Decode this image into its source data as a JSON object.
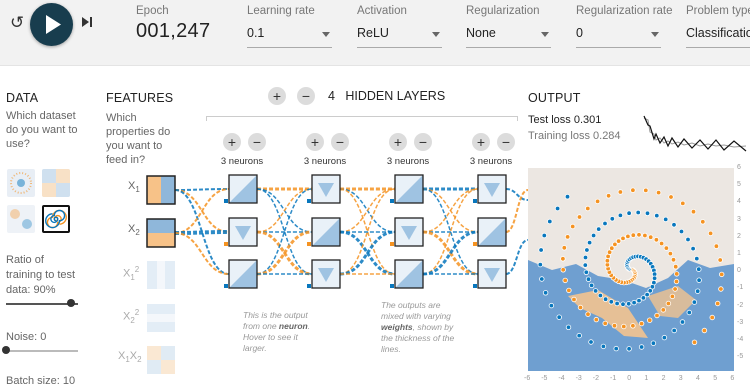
{
  "controls": {
    "reset_icon": "reset-icon",
    "play_icon": "play-icon",
    "step_icon": "step-icon"
  },
  "epoch": {
    "label": "Epoch",
    "value": "001,247"
  },
  "learning_rate": {
    "label": "Learning rate",
    "value": "0.1"
  },
  "activation": {
    "label": "Activation",
    "value": "ReLU"
  },
  "regularization": {
    "label": "Regularization",
    "value": "None"
  },
  "regularization_rate": {
    "label": "Regularization rate",
    "value": "0"
  },
  "problem_type": {
    "label": "Problem type",
    "value": "Classification"
  },
  "data": {
    "heading": "DATA",
    "question": "Which dataset do you want to use?",
    "datasets": [
      "circle",
      "xor",
      "gaussian",
      "spiral"
    ],
    "selected_dataset": "spiral",
    "ratio_label": "Ratio of training to test data:",
    "ratio_value": "90%",
    "ratio_fraction": 0.9,
    "noise_label": "Noise:",
    "noise_value": "0",
    "noise_fraction": 0,
    "batch_label": "Batch size:",
    "batch_value": "10"
  },
  "features": {
    "heading": "FEATURES",
    "question": "Which properties do you want to feed in?",
    "items": [
      {
        "label": "X",
        "sub": "1",
        "sup": "",
        "active": true
      },
      {
        "label": "X",
        "sub": "2",
        "sup": "",
        "active": true
      },
      {
        "label": "X",
        "sub": "1",
        "sup": "2",
        "active": false
      },
      {
        "label": "X",
        "sub": "2",
        "sup": "2",
        "active": false
      },
      {
        "label": "X",
        "sub": "1",
        "sup": "",
        "label2": "X",
        "sub2": "2",
        "active": false
      }
    ]
  },
  "network": {
    "plus": "+",
    "minus": "−",
    "layer_count": "4",
    "layers_label": "HIDDEN LAYERS",
    "layers": [
      {
        "neurons_label": "3 neurons"
      },
      {
        "neurons_label": "3 neurons"
      },
      {
        "neurons_label": "3 neurons"
      },
      {
        "neurons_label": "3 neurons"
      }
    ],
    "note1_pre": "This is the output from one ",
    "note1_bold": "neuron",
    "note1_post": ". Hover to see it larger.",
    "note2_pre": "The outputs are mixed with varying ",
    "note2_bold": "weights",
    "note2_post": ", shown by the thickness of the lines."
  },
  "output": {
    "heading": "OUTPUT",
    "test_loss_label": "Test loss",
    "test_loss": "0.301",
    "training_loss_label": "Training loss",
    "training_loss": "0.284",
    "y_ticks": [
      "6",
      "5",
      "4",
      "3",
      "2",
      "1",
      "0",
      "-1",
      "-2",
      "-3",
      "-4",
      "-5"
    ],
    "x_ticks": [
      "-6",
      "-5",
      "-4",
      "-3",
      "-2",
      "-1",
      "0",
      "1",
      "2",
      "3",
      "4",
      "5",
      "6"
    ]
  },
  "colors": {
    "orange": "#f59322",
    "blue": "#0877bd",
    "dark": "#183d4e",
    "light_blue": "#c5d8ea",
    "bg_gray": "#f2f2f2"
  }
}
